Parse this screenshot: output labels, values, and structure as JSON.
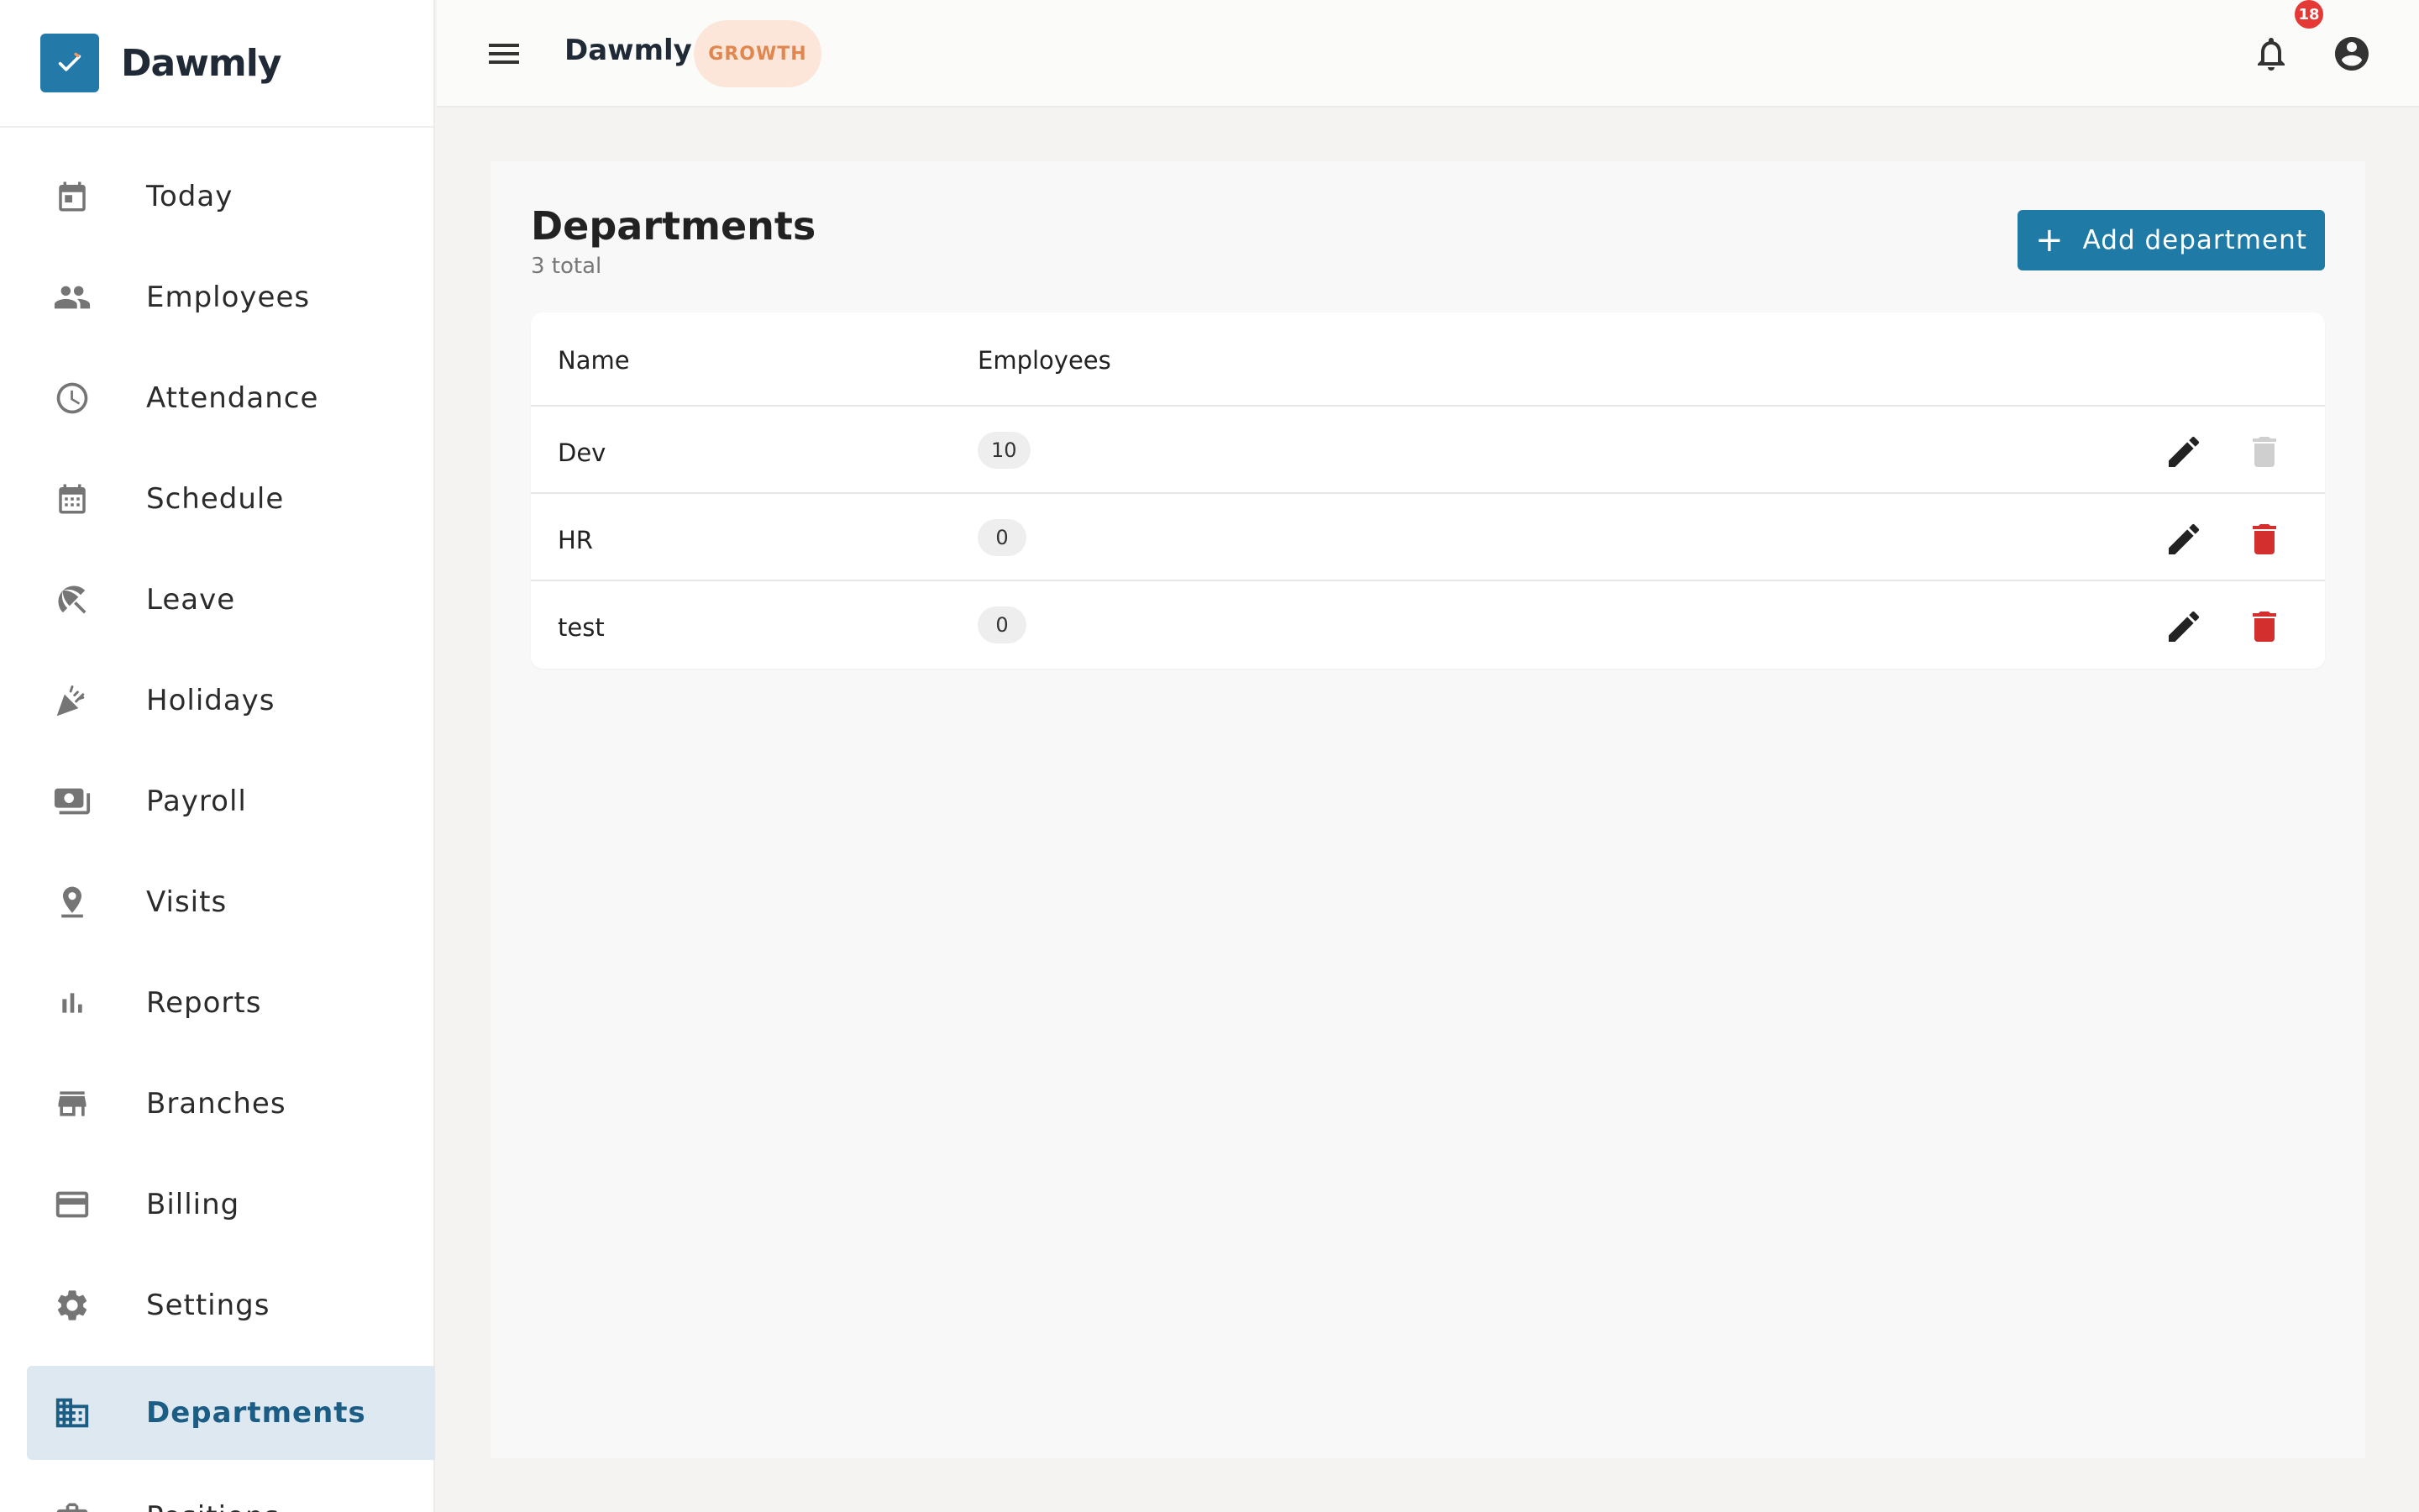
{
  "app": {
    "brand_name": "Dawmly",
    "brand_color": "#2379a8"
  },
  "sidebar": {
    "items": [
      {
        "label": "Today",
        "icon": "calendar-today-icon"
      },
      {
        "label": "Employees",
        "icon": "people-icon"
      },
      {
        "label": "Attendance",
        "icon": "clock-icon"
      },
      {
        "label": "Schedule",
        "icon": "calendar-grid-icon"
      },
      {
        "label": "Leave",
        "icon": "beach-umbrella-icon"
      },
      {
        "label": "Holidays",
        "icon": "party-popper-icon"
      },
      {
        "label": "Payroll",
        "icon": "money-icon"
      },
      {
        "label": "Visits",
        "icon": "location-pin-icon"
      },
      {
        "label": "Reports",
        "icon": "bar-chart-icon"
      },
      {
        "label": "Branches",
        "icon": "store-icon"
      },
      {
        "label": "Billing",
        "icon": "credit-card-icon"
      },
      {
        "label": "Settings",
        "icon": "gear-icon"
      },
      {
        "label": "Departments",
        "icon": "building-icon",
        "active": true
      },
      {
        "label": "Positions",
        "icon": "briefcase-icon"
      }
    ]
  },
  "topbar": {
    "title": "Dawmly",
    "plan_badge": "GROWTH",
    "notification_count": "18"
  },
  "page": {
    "title": "Departments",
    "subtitle": "3 total",
    "add_button_label": "Add department"
  },
  "table": {
    "columns": [
      "Name",
      "Employees"
    ],
    "rows": [
      {
        "name": "Dev",
        "employees": "10",
        "delete_disabled": true
      },
      {
        "name": "HR",
        "employees": "0",
        "delete_disabled": false
      },
      {
        "name": "test",
        "employees": "0",
        "delete_disabled": false
      }
    ]
  },
  "colors": {
    "accent": "#1f7aa6",
    "active_nav_bg": "#dde8f0",
    "active_nav_text": "#1b5d84",
    "badge_bg": "#fce6d9",
    "badge_text": "#e0874f",
    "delete_red": "#d32f2f",
    "notification_red": "#e53935"
  }
}
